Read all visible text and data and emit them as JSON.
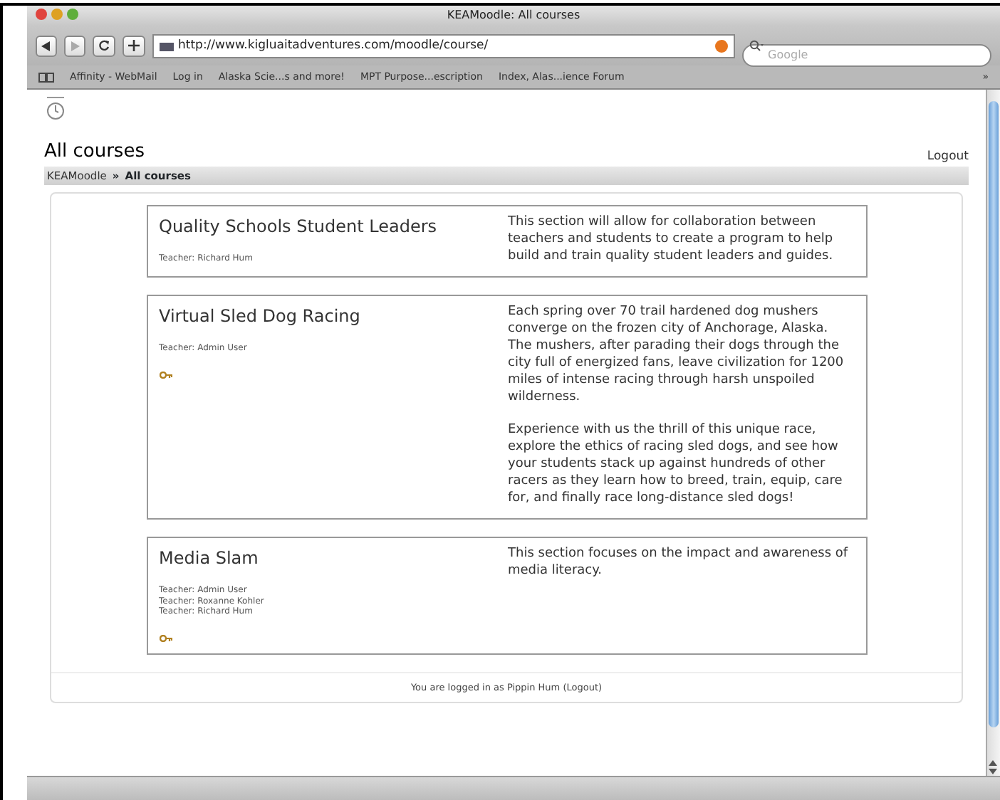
{
  "window": {
    "title": "KEAMoodle: All courses"
  },
  "toolbar": {
    "url": "http://www.kigluaitadventures.com/moodle/course/",
    "search": {
      "placeholder": "Google"
    }
  },
  "bookmarks": [
    "Affinity - WebMail",
    "Log in",
    "Alaska Scie...s and more!",
    "MPT Purpose...escription",
    "Index, Alas...ience Forum"
  ],
  "bookmarks_more": "»",
  "page": {
    "title": "All courses",
    "logout": "Logout",
    "breadcrumb": [
      {
        "label": "KEAMoodle",
        "link": true
      },
      {
        "label": "»",
        "link": false
      },
      {
        "label": "All courses",
        "link": false
      }
    ]
  },
  "courses": [
    {
      "name": "Quality Schools Student Leaders",
      "teachers": [
        "Teacher: Richard Hum"
      ],
      "guest_key": false,
      "description": [
        "This section will allow for collaboration between teachers and students to create a program to help build and train quality student leaders and guides."
      ]
    },
    {
      "name": "Virtual Sled Dog Racing",
      "teachers": [
        "Teacher: Admin User"
      ],
      "guest_key": true,
      "description": [
        "Each spring over 70 trail hardened dog mushers converge on the frozen city of Anchorage, Alaska. The mushers, after parading their dogs through the city full of energized fans, leave civilization for 1200 miles of intense racing through harsh unspoiled wilderness.",
        "Experience with us the thrill of this unique race, explore the ethics of racing sled dogs, and see how your students stack up against hundreds of other racers as they learn how to breed, train, equip, care for, and finally race long-distance sled dogs!"
      ]
    },
    {
      "name": "Media Slam",
      "teachers": [
        "Teacher: Admin User",
        "Teacher: Roxanne Kohler",
        "Teacher: Richard Hum"
      ],
      "guest_key": true,
      "description": [
        "This section focuses on the impact and awareness of media literacy."
      ]
    }
  ],
  "footer": {
    "text": "You are logged in as",
    "user": "Pippin Hum",
    "logout": "(Logout)"
  }
}
